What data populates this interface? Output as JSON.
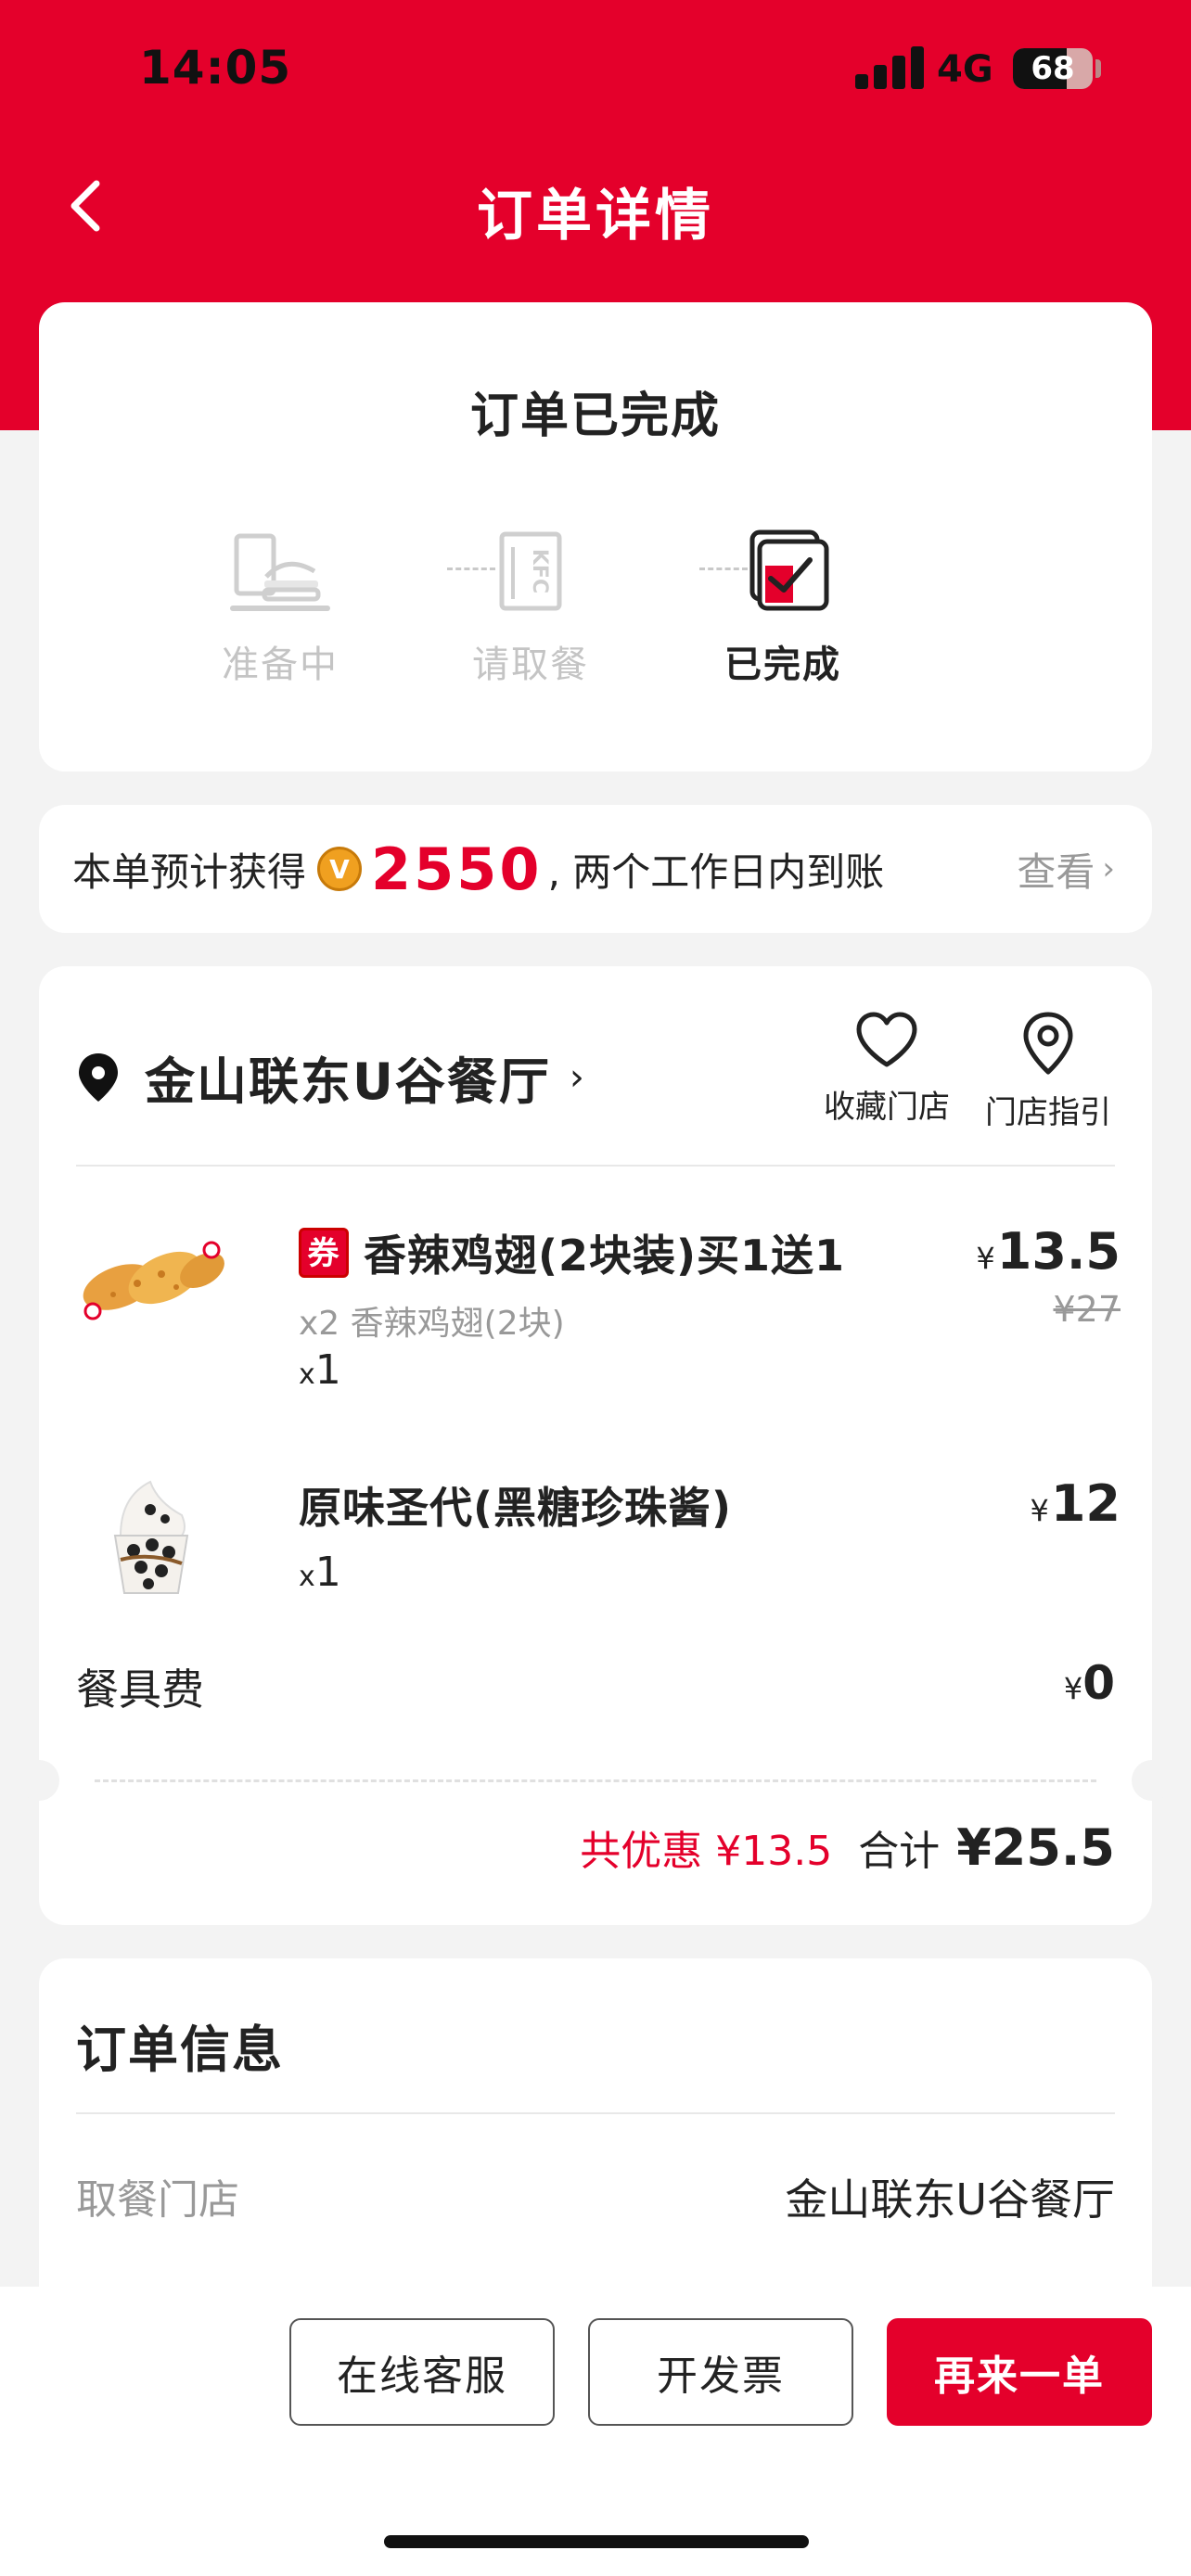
{
  "status_bar": {
    "time": "14:05",
    "network": "4G",
    "battery": "68",
    "battery_level_percent": 68
  },
  "nav": {
    "title": "订单详情",
    "back_icon": "chevron-left-icon"
  },
  "order_status": {
    "title": "订单已完成",
    "steps": [
      {
        "label": "准备中",
        "icon": "tray-burger-icon",
        "active": false
      },
      {
        "label": "请取餐",
        "icon": "kfc-bag-icon",
        "active": false
      },
      {
        "label": "已完成",
        "icon": "completed-check-icon",
        "active": true
      }
    ]
  },
  "points": {
    "prefix": "本单预计获得",
    "coin_icon": "v-coin-icon",
    "coin_letter": "V",
    "amount": "2550",
    "suffix": ", 两个工作日内到账",
    "view_label": "查看",
    "view_chevron": "›"
  },
  "store": {
    "name": "金山联东U谷餐厅",
    "chevron": "›",
    "favorite_label": "收藏门店",
    "guide_label": "门店指引"
  },
  "items": [
    {
      "coupon_badge": "券",
      "name": "香辣鸡翅(2块装)买1送1",
      "detail": "x2 香辣鸡翅(2块)",
      "qty_prefix": "x",
      "qty": "1",
      "price_symbol": "¥",
      "price": "13.5",
      "original_price": "¥27"
    },
    {
      "name": "原味圣代(黑糖珍珠酱)",
      "qty_prefix": "x",
      "qty": "1",
      "price_symbol": "¥",
      "price": "12"
    }
  ],
  "fee": {
    "label": "餐具费",
    "symbol": "¥",
    "value": "0"
  },
  "totals": {
    "discount": "共优惠 ¥13.5",
    "total_label": "合计",
    "total_value": "¥25.5"
  },
  "order_info": {
    "title": "订单信息",
    "pickup_store_label": "取餐门店",
    "pickup_store_value": "金山联东U谷餐厅"
  },
  "actions": {
    "customer_service": "在线客服",
    "invoice": "开发票",
    "reorder": "再来一单"
  },
  "colors": {
    "brand_red": "#e4002b",
    "background": "#f3f3f3",
    "muted": "#999999"
  }
}
